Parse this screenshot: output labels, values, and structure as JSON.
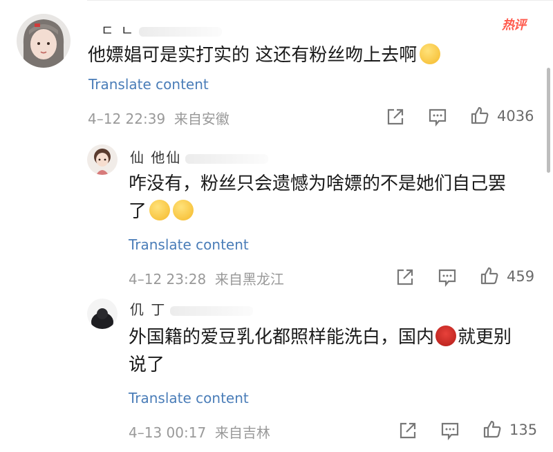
{
  "comments": [
    {
      "username": "ㄷ ㄴ",
      "badge": "热评",
      "text": "他嫖娼可是实打实的 这还有粉丝吻上去啊",
      "emoji": "sweat-smile-emoji",
      "translate": "Translate content",
      "time": "4–12 22:39",
      "location": "来自安徽",
      "likes": "4036"
    },
    {
      "username": "仙 他仙",
      "text_line1": "咋没有，粉丝只会遗憾为啥嫖的不是她们自己罢",
      "text_line2": "了",
      "emoji": "laugh-cry-emoji",
      "translate": "Translate content",
      "time": "4–12 23:28",
      "location": "来自黑龙江",
      "likes": "459"
    },
    {
      "username": "仉 丁",
      "text_line1_a": "外国籍的爱豆乳化都照样能洗白，国内",
      "text_line1_b": "就更别",
      "text_line2": "说了",
      "emoji": "ladybug-emoji",
      "translate": "Translate content",
      "time": "4–13 00:17",
      "location": "来自吉林",
      "likes": "135"
    }
  ],
  "colors": {
    "link": "#4a7db8",
    "meta": "#999999",
    "hot": "#ff5a4d"
  }
}
